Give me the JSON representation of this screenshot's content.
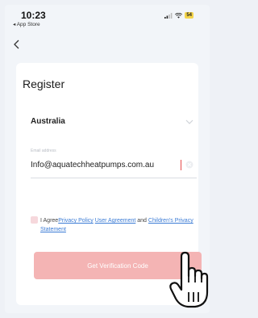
{
  "status_bar": {
    "time": "10:23",
    "back_app": "◂ App Store",
    "battery": "54"
  },
  "register": {
    "title": "Register",
    "country": "Australia",
    "email_placeholder": "Email address",
    "email_value": "Info@aquatechheatpumps.com.au",
    "agree_prefix": "I Agree",
    "privacy_policy": "Privacy Policy",
    "user_agreement": "User Agreement",
    "and": " and ",
    "children_privacy": "Children's Privacy Statement",
    "button_label": "Get Verification Code"
  },
  "icons": {
    "back": "chevron-left-icon",
    "dropdown": "chevron-down-icon",
    "clear": "clear-icon",
    "cursor": "hand-pointer-icon"
  },
  "colors": {
    "link": "#3a7bd5",
    "button": "#f4b4b4",
    "battery": "#f4d44a"
  }
}
